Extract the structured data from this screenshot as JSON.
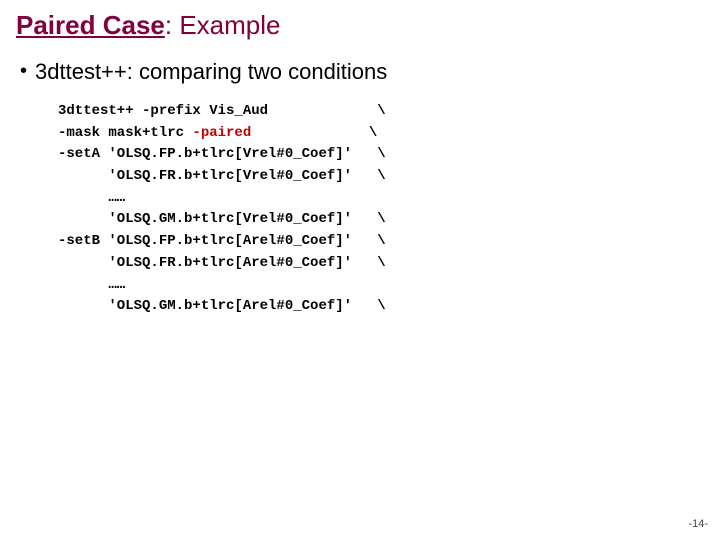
{
  "title": {
    "main": "Paired Case",
    "rest": ": Example"
  },
  "bullet": "3dttest++: comparing two conditions",
  "code": {
    "l1a": "3dttest++ -prefix Vis_Aud",
    "l1b": "             \\",
    "l2a": "-mask mask+tlrc ",
    "l2hl": "-paired",
    "l2b": "              \\",
    "l3a": "-setA 'OLSQ.FP.b+tlrc[Vrel#0_Coef]'   \\",
    "l4a": "      'OLSQ.FR.b+tlrc[Vrel#0_Coef]'   \\",
    "l5a": "      ……",
    "l6a": "      'OLSQ.GM.b+tlrc[Vrel#0_Coef]'   \\",
    "l7a": "-setB 'OLSQ.FP.b+tlrc[Arel#0_Coef]'   \\",
    "l8a": "      'OLSQ.FR.b+tlrc[Arel#0_Coef]'   \\",
    "l9a": "      ……",
    "l10a": "      'OLSQ.GM.b+tlrc[Arel#0_Coef]'   \\"
  },
  "pager": "-14-"
}
